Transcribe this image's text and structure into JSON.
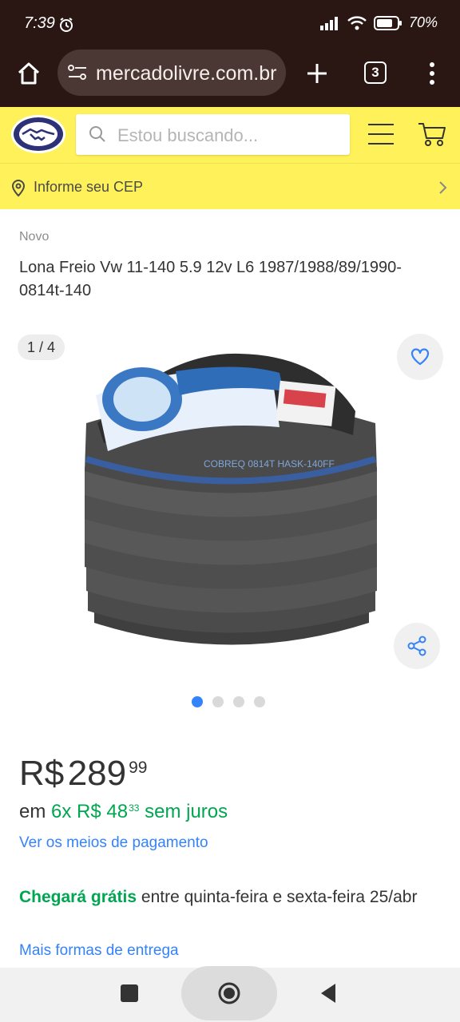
{
  "status_bar": {
    "time": "7:39",
    "battery": "70%"
  },
  "browser": {
    "url": "mercadolivre.com.br",
    "tab_count": "3"
  },
  "header": {
    "search_placeholder": "Estou buscando..."
  },
  "cep": {
    "label": "Informe seu CEP"
  },
  "product": {
    "condition": "Novo",
    "title": "Lona Freio Vw 11-140 5.9 12v L6 1987/1988/89/1990-0814t-140",
    "image_counter": "1 / 4",
    "image_count": 4,
    "active_image": 1,
    "price_currency": "R$",
    "price_whole": "289",
    "price_cents": "99",
    "installments_prefix": "em",
    "installments_value": "6x R$ 48",
    "installments_cents": "33",
    "installments_suffix": "sem juros",
    "payment_link": "Ver os meios de pagamento",
    "shipping_highlight": "Chegará grátis",
    "shipping_text": "entre quinta-feira e sexta-feira 25/abr",
    "shipping_link": "Mais formas de entrega",
    "image_text": "COBREQ 0814T HASK-140FF"
  },
  "colors": {
    "brand_yellow": "#fff159",
    "accent_blue": "#3483fa",
    "green": "#00a650",
    "status_bar_bg": "#2a1713"
  },
  "icons": [
    "alarm-icon",
    "signal-icon",
    "wifi-icon",
    "battery-icon",
    "home-icon",
    "site-settings-icon",
    "new-tab-icon",
    "tabs-icon",
    "more-icon",
    "mercadolivre-logo",
    "search-icon",
    "menu-icon",
    "cart-icon",
    "location-pin-icon",
    "chevron-right-icon",
    "heart-icon",
    "share-icon",
    "recents-icon",
    "home-nav-icon",
    "back-icon"
  ]
}
